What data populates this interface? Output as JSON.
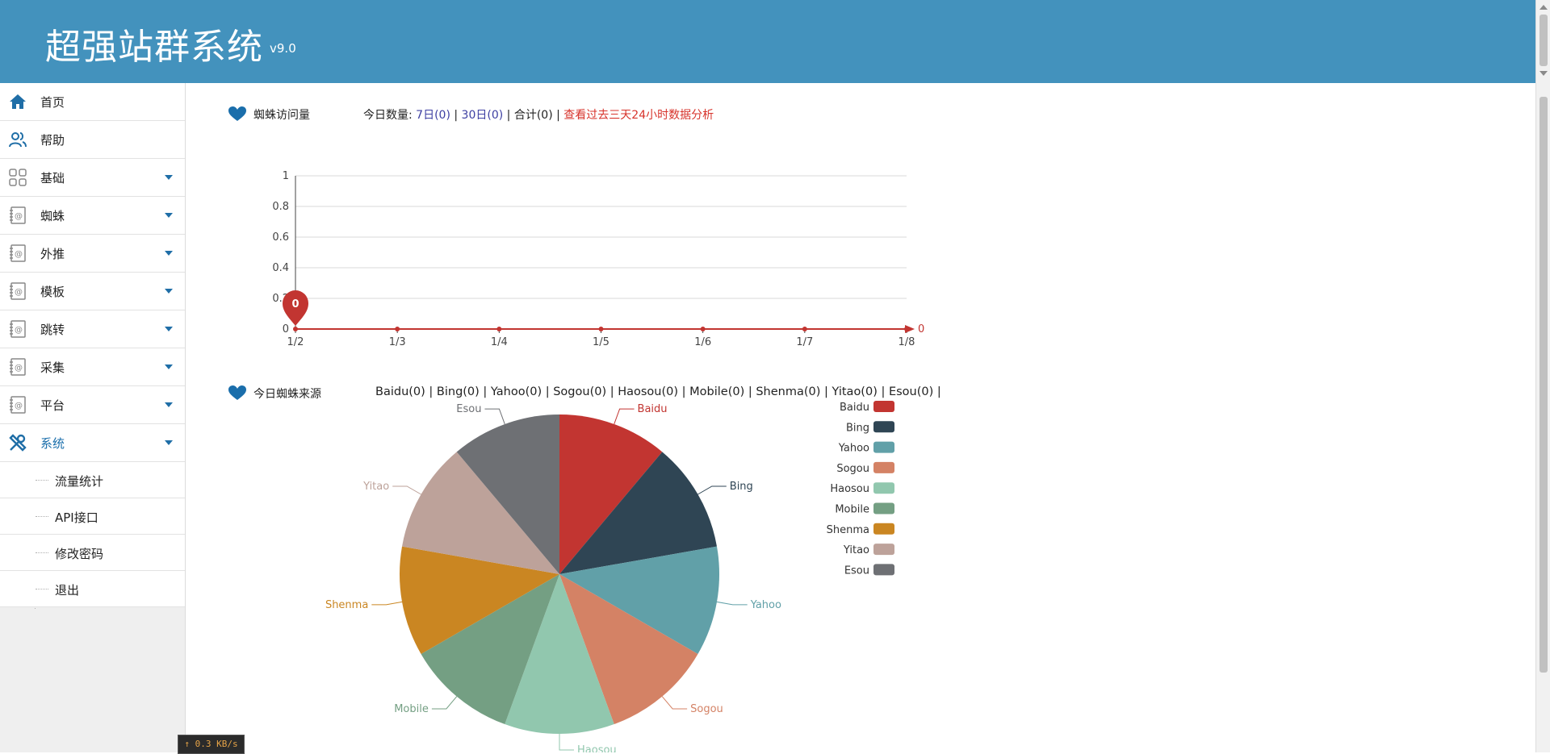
{
  "header": {
    "title": "超强站群系统",
    "version": "v9.0"
  },
  "sidebar": {
    "items": [
      {
        "label": "首页",
        "icon": "home-icon",
        "has_caret": false
      },
      {
        "label": "帮助",
        "icon": "users-icon",
        "has_caret": false
      },
      {
        "label": "基础",
        "icon": "grid-icon",
        "has_caret": true
      },
      {
        "label": "蜘蛛",
        "icon": "address-book-icon",
        "has_caret": true
      },
      {
        "label": "外推",
        "icon": "address-book-icon",
        "has_caret": true
      },
      {
        "label": "模板",
        "icon": "address-book-icon",
        "has_caret": true
      },
      {
        "label": "跳转",
        "icon": "address-book-icon",
        "has_caret": true
      },
      {
        "label": "采集",
        "icon": "address-book-icon",
        "has_caret": true
      },
      {
        "label": "平台",
        "icon": "address-book-icon",
        "has_caret": true
      },
      {
        "label": "系统",
        "icon": "wrench-icon",
        "has_caret": true,
        "active": true
      }
    ],
    "sub_items": [
      "流量统计",
      "API接口",
      "修改密码",
      "退出"
    ]
  },
  "visits": {
    "heading": "蜘蛛访问量",
    "today_label": "今日数量:",
    "link_7d": "7日(0)",
    "sep1": "|",
    "link_30d": "30日(0)",
    "sep2": "|",
    "total": "合计(0)",
    "sep3": "|",
    "analysis_link": "查看过去三天24小时数据分析"
  },
  "sources": {
    "heading": "今日蜘蛛来源",
    "counts": "Baidu(0) | Bing(0) | Yahoo(0) | Sogou(0) | Haosou(0) | Mobile(0) | Shenma(0) | Yitao(0) | Esou(0) |"
  },
  "colors": {
    "header_bg": "#4392bd",
    "accent": "#1a6eab",
    "line": "#c23531"
  },
  "chart_data": [
    {
      "type": "line",
      "x": [
        "1/2",
        "1/3",
        "1/4",
        "1/5",
        "1/6",
        "1/7",
        "1/8"
      ],
      "series": [
        {
          "values": [
            0,
            0,
            0,
            0,
            0,
            0,
            0
          ]
        }
      ],
      "ylim": [
        0,
        1
      ],
      "yticks": [
        "0",
        "0.2",
        "0.4",
        "0.6",
        "0.8",
        "1"
      ],
      "grid": true,
      "markpoint_label": "0",
      "end_label": "0"
    },
    {
      "type": "pie",
      "categories": [
        "Baidu",
        "Bing",
        "Yahoo",
        "Sogou",
        "Haosou",
        "Mobile",
        "Shenma",
        "Yitao",
        "Esou"
      ],
      "values": [
        0,
        0,
        0,
        0,
        0,
        0,
        0,
        0,
        0
      ],
      "colors": [
        "#c23531",
        "#2f4554",
        "#61a0a8",
        "#d48265",
        "#91c7ae",
        "#749f83",
        "#ca8622",
        "#bda29a",
        "#6e7074"
      ],
      "legend": "right"
    }
  ],
  "status": {
    "netspeed": "↑ 0.3 KB/s"
  }
}
